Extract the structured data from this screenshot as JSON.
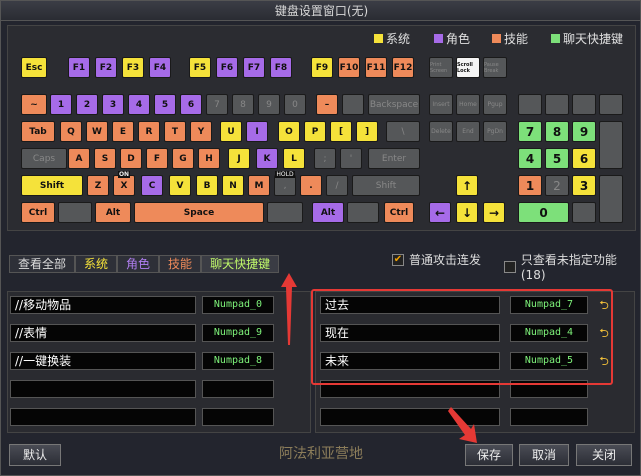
{
  "window": {
    "title": "键盘设置窗口(无)"
  },
  "legend": [
    {
      "label": "系统",
      "color": "#f5e23a"
    },
    {
      "label": "角色",
      "color": "#a66be8"
    },
    {
      "label": "技能",
      "color": "#ee8a5a"
    },
    {
      "label": "聊天快捷键",
      "color": "#7de07a"
    }
  ],
  "keys": {
    "esc": "Esc",
    "f1": "F1",
    "f2": "F2",
    "f3": "F3",
    "f4": "F4",
    "f5": "F5",
    "f6": "F6",
    "f7": "F7",
    "f8": "F8",
    "f9": "F9",
    "f10": "F10",
    "f11": "F11",
    "f12": "F12",
    "print": "Print Screen",
    "scroll": "Scroll Lock",
    "pause": "Pause Break",
    "tilde": "~",
    "n1": "1",
    "n2": "2",
    "n3": "3",
    "n4": "4",
    "n5": "5",
    "n6": "6",
    "n7": "7",
    "n8": "8",
    "n9": "9",
    "n0": "0",
    "minus": "–",
    "eq": "",
    "backspace": "Backspace",
    "insert": "Insert",
    "home": "Home",
    "pgup": "Pgup",
    "tab": "Tab",
    "q": "Q",
    "w": "W",
    "e": "E",
    "r": "R",
    "t": "T",
    "y": "Y",
    "u": "U",
    "i": "I",
    "o": "O",
    "pp": "P",
    "lb": "[",
    "rb": "]",
    "bs": "\\",
    "delete": "Delete",
    "end": "End",
    "pgdn": "PgDn",
    "caps": "Caps",
    "a": "A",
    "s": "S",
    "d": "D",
    "f": "F",
    "g": "G",
    "h": "H",
    "j": "J",
    "k": "K",
    "l": "L",
    "semi": ";",
    "quote": "'",
    "enter": "Enter",
    "shift": "Shift",
    "z": "Z",
    "x": "X",
    "c": "C",
    "v": "V",
    "b": "B",
    "nn": "N",
    "m": "M",
    "comma": ",",
    "dot": ".",
    "slash": "/",
    "rshift": "Shift",
    "lctrl": "Ctrl",
    "lalt": "Alt",
    "space": "Space",
    "ralt": "Alt",
    "rctrl": "Ctrl",
    "up": "↑",
    "left": "←",
    "down": "↓",
    "right": "→",
    "kp7": "7",
    "kp8": "8",
    "kp9": "9",
    "kp4": "4",
    "kp5": "5",
    "kp6": "6",
    "kp1": "1",
    "kp2": "2",
    "kp3": "3",
    "kp0": "0"
  },
  "key_tags": {
    "x": "ON",
    "m": "HOLD"
  },
  "tabs": [
    "查看全部",
    "系统",
    "角色",
    "技能",
    "聊天快捷键"
  ],
  "options": {
    "auto_attack": "普通攻击连发",
    "unassigned": "只查看未指定功能(18)"
  },
  "left_list": [
    {
      "name": "//移动物品",
      "key": "Numpad_0"
    },
    {
      "name": "//表情",
      "key": "Numpad_9"
    },
    {
      "name": "//一键换装",
      "key": "Numpad_8"
    }
  ],
  "right_list": [
    {
      "name": "过去",
      "key": "Numpad_7"
    },
    {
      "name": "现在",
      "key": "Numpad_4"
    },
    {
      "name": "未来",
      "key": "Numpad_5"
    }
  ],
  "buttons": {
    "default": "默认",
    "save": "保存",
    "cancel": "取消",
    "close": "关闭"
  },
  "background_text": "阿法利亚营地"
}
